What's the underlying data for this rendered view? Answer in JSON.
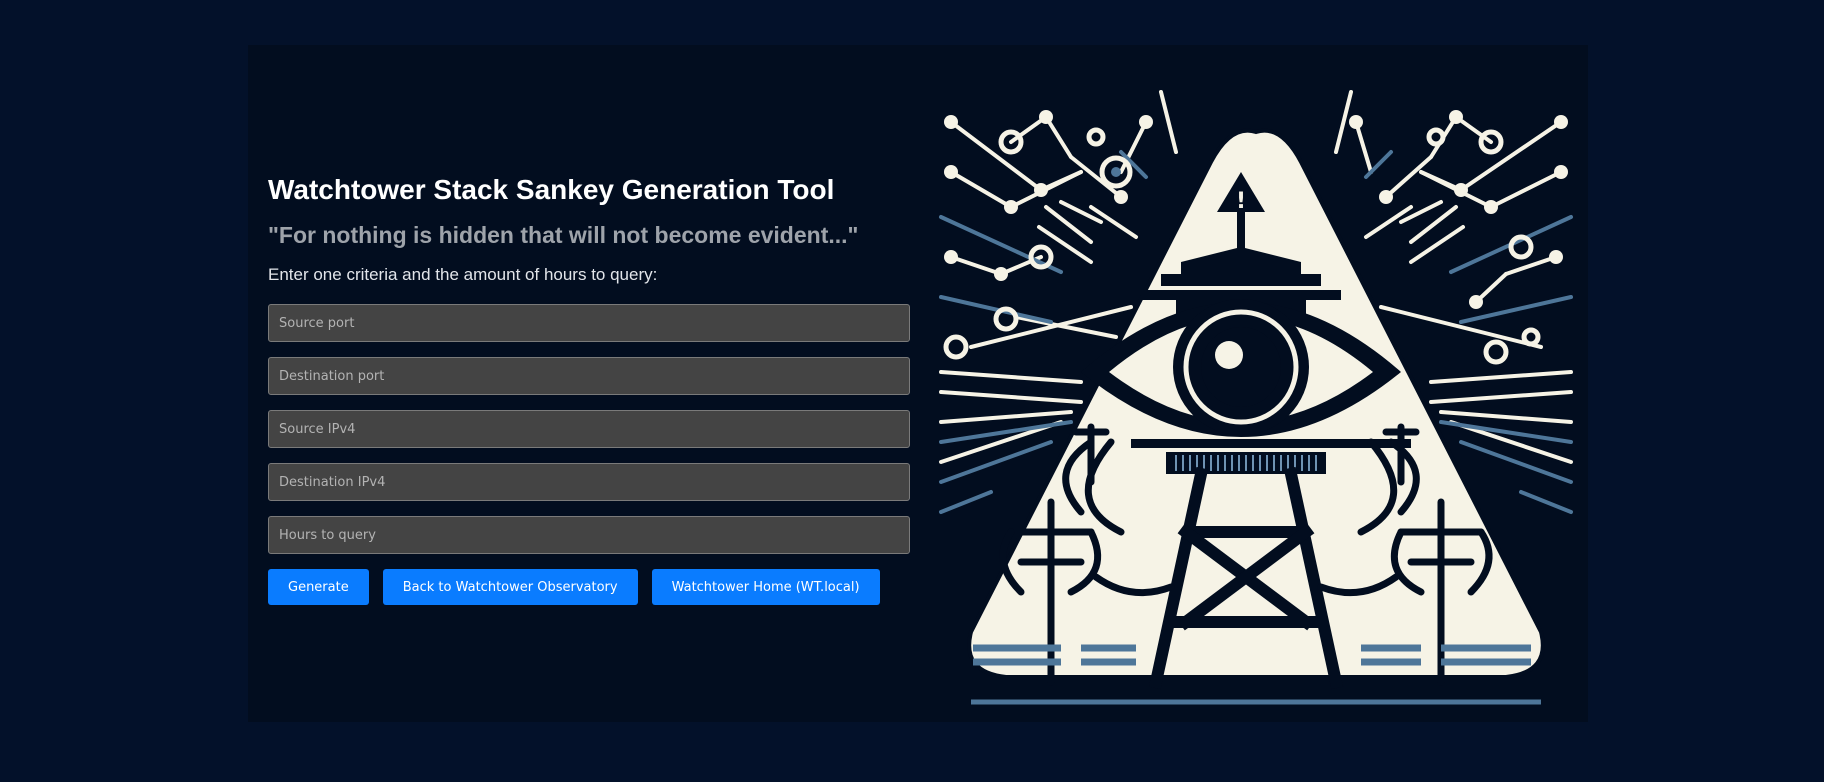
{
  "header": {
    "title": "Watchtower Stack Sankey Generation Tool",
    "quote": "\"For nothing is hidden that will not become evident...\"",
    "instructions": "Enter one criteria and the amount of hours to query:"
  },
  "form": {
    "source_port_placeholder": "Source port",
    "destination_port_placeholder": "Destination port",
    "source_ipv4_placeholder": "Source IPv4",
    "destination_ipv4_placeholder": "Destination IPv4",
    "hours_placeholder": "Hours to query"
  },
  "buttons": {
    "generate": "Generate",
    "back": "Back to Watchtower Observatory",
    "home": "Watchtower Home (WT.local)"
  },
  "illustration": {
    "icon": "all-seeing-eye-watchtower-icon",
    "warning_icon": "warning-icon"
  },
  "colors": {
    "page_bg": "#03112a",
    "card_bg": "#020d1f",
    "accent": "#0a7cff",
    "triangle_fill": "#f6f3e6",
    "line_blue": "#4e7699"
  }
}
